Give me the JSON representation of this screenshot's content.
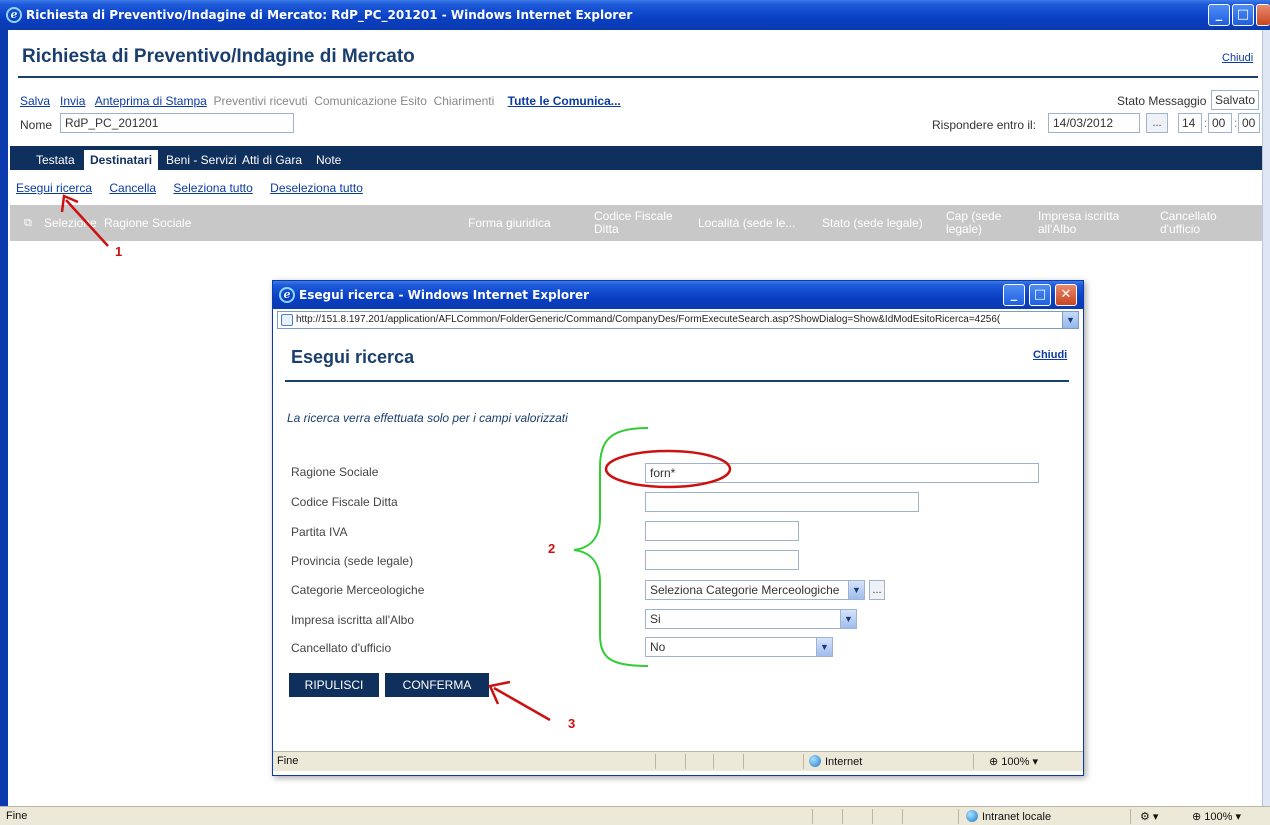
{
  "window": {
    "title": "Richiesta di Preventivo/Indagine di Mercato: RdP_PC_201201 - Windows Internet Explorer",
    "minimize": "_",
    "maximize": "□",
    "close": "✕"
  },
  "header": {
    "title": "Richiesta di Preventivo/Indagine di Mercato",
    "close_link": "Chiudi"
  },
  "toolbar": {
    "salva": "Salva",
    "invia": "Invia",
    "anteprima": "Anteprima di Stampa",
    "preventivi": "Preventivi ricevuti",
    "comunicazione": "Comunicazione Esito",
    "chiarimenti": "Chiarimenti",
    "tutte": "Tutte le Comunica...",
    "stato_label": "Stato Messaggio",
    "stato_value": "Salvato"
  },
  "form": {
    "nome_label": "Nome",
    "nome_value": "RdP_PC_201201",
    "rispondere_label": "Rispondere entro il:",
    "date_value": "14/03/2012",
    "date_btn": "...",
    "hh": "14",
    "mm": "00",
    "ss": "00"
  },
  "tabs": [
    "Testata",
    "Destinatari",
    "Beni - Servizi",
    "Atti di Gara",
    "Note"
  ],
  "actions": {
    "esegui": "Esegui ricerca",
    "cancella": "Cancella",
    "seleziona": "Seleziona tutto",
    "deseleziona": "Deseleziona tutto"
  },
  "grid": {
    "icon": "⧉",
    "columns": {
      "selezione": "Selezione",
      "ragione": "Ragione Sociale",
      "forma": "Forma giuridica",
      "codice1": "Codice Fiscale",
      "codice2": "Ditta",
      "localita": "Località (sede le...",
      "stato": "Stato (sede legale)",
      "cap1": "Cap (sede",
      "cap2": "legale)",
      "impresa1": "Impresa iscritta",
      "impresa2": "all'Albo",
      "cancellato1": "Cancellato",
      "cancellato2": "d'ufficio"
    }
  },
  "popup": {
    "title": "Esegui ricerca - Windows Internet Explorer",
    "address": "http://151.8.197.201/application/AFLCommon/FolderGeneric/Command/CompanyDes/FormExecuteSearch.asp?ShowDialog=Show&IdModEsitoRicerca=4256(",
    "heading": "Esegui ricerca",
    "close_link": "Chiudi",
    "note": "La ricerca verra effettuata solo per i campi valorizzati",
    "fields": {
      "ragione_label": "Ragione Sociale",
      "ragione_value": "forn*",
      "codice_label": "Codice Fiscale Ditta",
      "partita_label": "Partita IVA",
      "provincia_label": "Provincia (sede legale)",
      "categorie_label": "Categorie Merceologiche",
      "categorie_value": "Seleziona Categorie Merceologiche",
      "categorie_btn": "...",
      "impresa_label": "Impresa iscritta all'Albo",
      "impresa_value": "Si",
      "cancellato_label": "Cancellato d'ufficio",
      "cancellato_value": "No"
    },
    "buttons": {
      "ripulisci": "RIPULISCI",
      "conferma": "CONFERMA"
    },
    "status": {
      "left": "Fine",
      "zone": "Internet",
      "zoom": "100%"
    }
  },
  "statusbar": {
    "left": "Fine",
    "zone": "Intranet locale",
    "zoom": "100%"
  },
  "annotations": {
    "n1": "1",
    "n2": "2",
    "n3": "3"
  },
  "colors": {
    "navy": "#0f2f5c",
    "link": "#0b3aa0",
    "annotation_red": "#cc1111",
    "brace_green": "#33cc33"
  }
}
